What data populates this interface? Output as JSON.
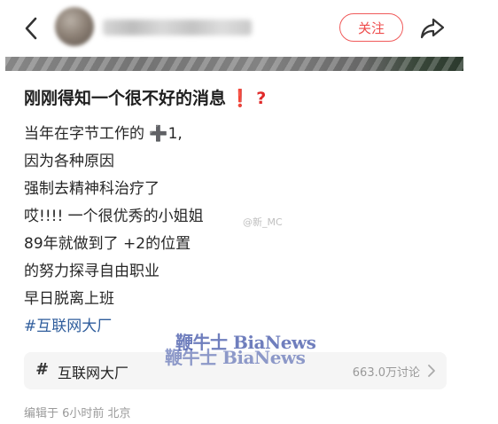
{
  "header": {
    "back_icon": "chevron-left-icon",
    "follow_label": "关注",
    "share_icon": "share-arrow-icon"
  },
  "post": {
    "title": "刚刚得知一个很不好的消息",
    "title_marks": "❗ ?",
    "lines": [
      "当年在字节工作的 ➕1,",
      "因为各种原因",
      "强制去精神科治疗了",
      "哎!!!! 一个很优秀的小姐姐",
      "89年就做到了 +2的位置",
      "的努力探寻自由职业",
      "早日脱离上班"
    ],
    "hashtag": "#互联网大厂"
  },
  "watermarks": {
    "weibo": "@新_MC",
    "bia_1": "鞭牛士 BiaNews",
    "bia_2": "鞭牛士 BiaNews"
  },
  "topic_card": {
    "hash_symbol": "#",
    "name": "互联网大厂",
    "count": "663.0万讨论",
    "chevron_icon": "chevron-right-icon"
  },
  "meta": {
    "text": "编辑于 6小时前 北京"
  },
  "colors": {
    "accent_red": "#ee4b4b",
    "hashtag_blue": "#2f5d9c",
    "muted_gray": "#9a9a9a"
  }
}
